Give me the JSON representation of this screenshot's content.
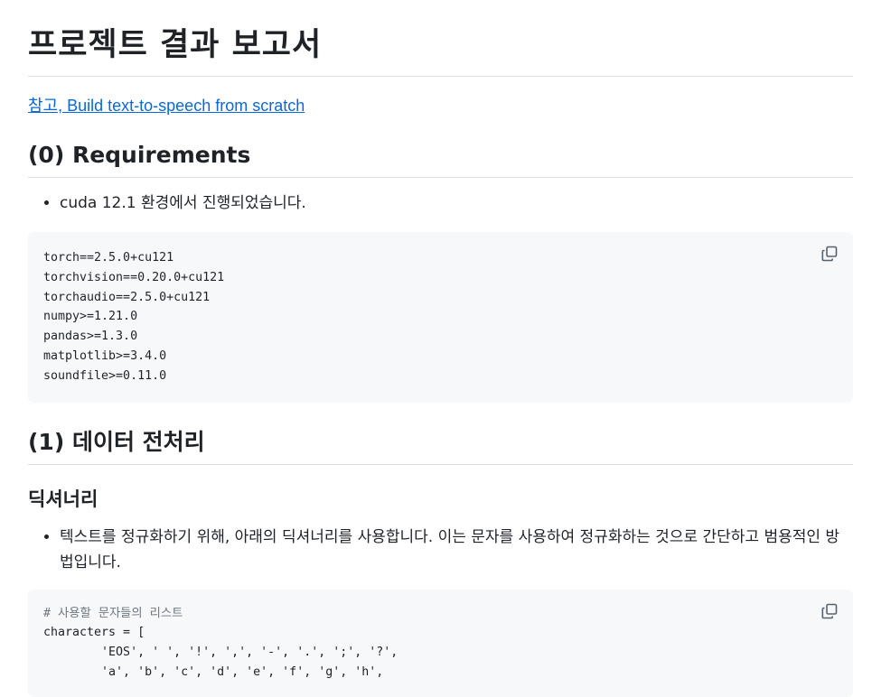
{
  "doc": {
    "title": "프로젝트 결과 보고서",
    "reference_link": "참고, Build text-to-speech from scratch"
  },
  "sections": [
    {
      "heading": "(0) Requirements",
      "bullets": [
        "cuda 12.1 환경에서 진행되었습니다."
      ],
      "code": [
        "torch==2.5.0+cu121",
        "torchvision==0.20.0+cu121",
        "torchaudio==2.5.0+cu121",
        "numpy>=1.21.0",
        "pandas>=1.3.0",
        "matplotlib>=3.4.0",
        "soundfile>=0.11.0"
      ]
    },
    {
      "heading": "(1) 데이터 전처리",
      "subheading": "딕셔너리",
      "bullets": [
        "텍스트를 정규화하기 위해, 아래의 딕셔너리를 사용합니다. 이는 문자를 사용하여 정규화하는 것으로 간단하고 범용적인 방법입니다."
      ],
      "code_comment": "# 사용할 문자들의 리스트",
      "code": [
        "characters = [",
        "        'EOS', ' ', '!', ',', '-', '.', ';', '?',",
        "        'a', 'b', 'c', 'd', 'e', 'f', 'g', 'h',"
      ]
    }
  ],
  "icons": {
    "copy": "copy-icon"
  }
}
